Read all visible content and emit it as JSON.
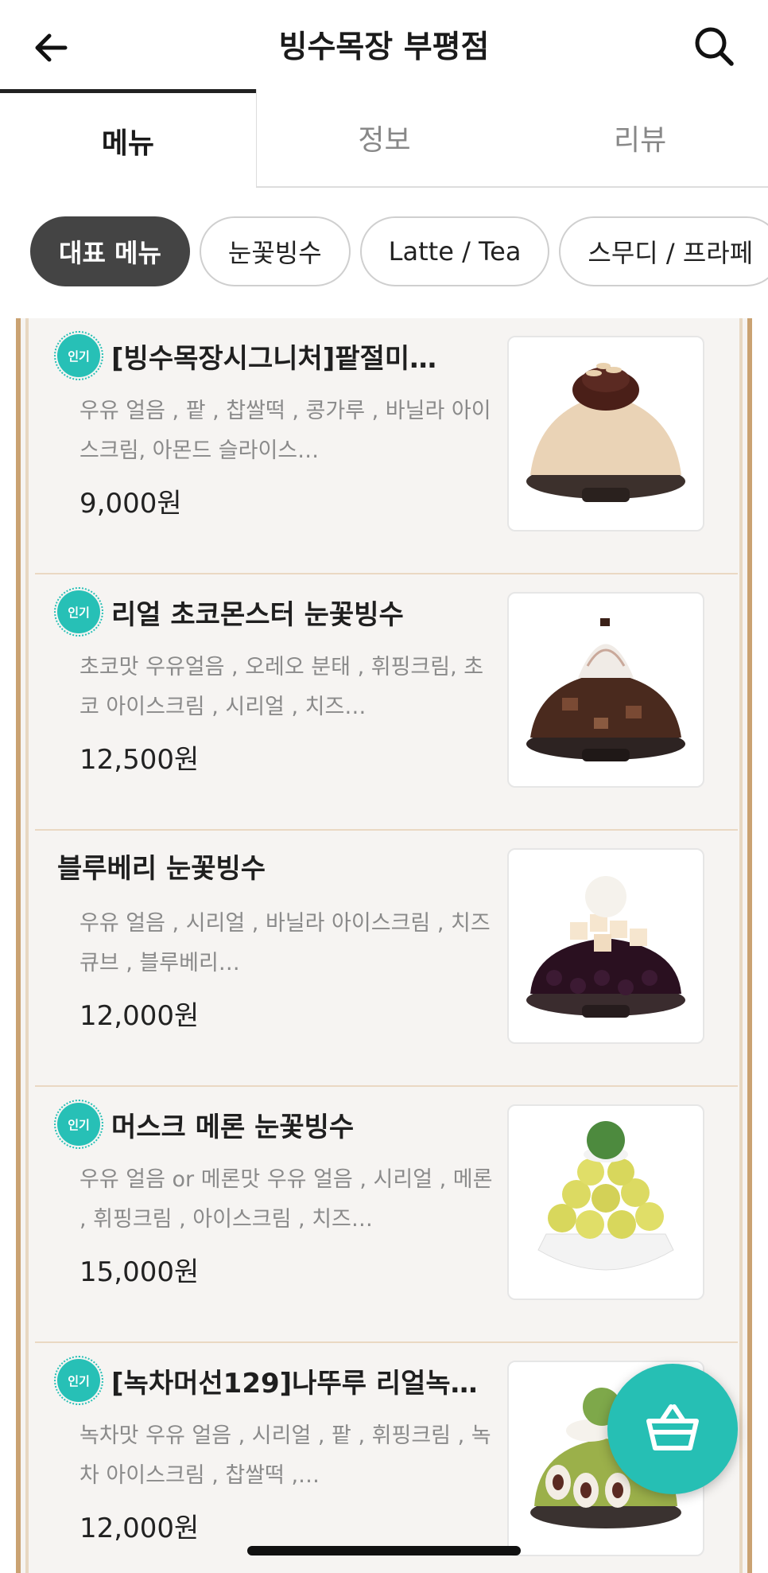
{
  "header": {
    "title": "빙수목장 부평점",
    "back_icon": "arrow-left-icon",
    "search_icon": "search-icon"
  },
  "tabs": [
    {
      "label": "메뉴",
      "active": true
    },
    {
      "label": "정보",
      "active": false
    },
    {
      "label": "리뷰",
      "active": false
    }
  ],
  "categories": [
    {
      "label": "대표 메뉴",
      "active": true
    },
    {
      "label": "눈꽃빙수",
      "active": false
    },
    {
      "label": "Latte / Tea",
      "active": false
    },
    {
      "label": "스무디 / 프라페",
      "active": false
    }
  ],
  "badge_label": "인기",
  "menu_items": [
    {
      "name": "[빙수목장시그니처]팥절미…",
      "popular": true,
      "description": "우유 얼음 , 팥 , 찹쌀떡 , 콩가루 , 바닐라 아이스크림, 아몬드 슬라이스…",
      "price": "9,000원"
    },
    {
      "name": "리얼 초코몬스터 눈꽃빙수",
      "popular": true,
      "description": "초코맛 우유얼음 , 오레오 분태 , 휘핑크림, 초코 아이스크림 , 시리얼 , 치즈…",
      "price": "12,500원"
    },
    {
      "name": "블루베리 눈꽃빙수",
      "popular": false,
      "description": "우유 얼음 , 시리얼 , 바닐라 아이스크림 , 치즈큐브 , 블루베리…",
      "price": "12,000원"
    },
    {
      "name": "머스크 메론 눈꽃빙수",
      "popular": true,
      "description": "우유 얼음 or 메론맛 우유 얼음 , 시리얼 , 메론 , 휘핑크림 , 아이스크림 , 치즈…",
      "price": "15,000원"
    },
    {
      "name": "[녹차머선129]나뚜루 리얼녹…",
      "popular": true,
      "description": "녹차맛 우유 얼음 , 시리얼 , 팥 , 휘핑크림 , 녹차 아이스크림 , 찹쌀떡 ,…",
      "price": "12,000원"
    }
  ],
  "fab_icon": "basket-icon",
  "colors": {
    "accent": "#26bfb4",
    "border_gold": "#caa272",
    "chip_active": "#444444"
  }
}
